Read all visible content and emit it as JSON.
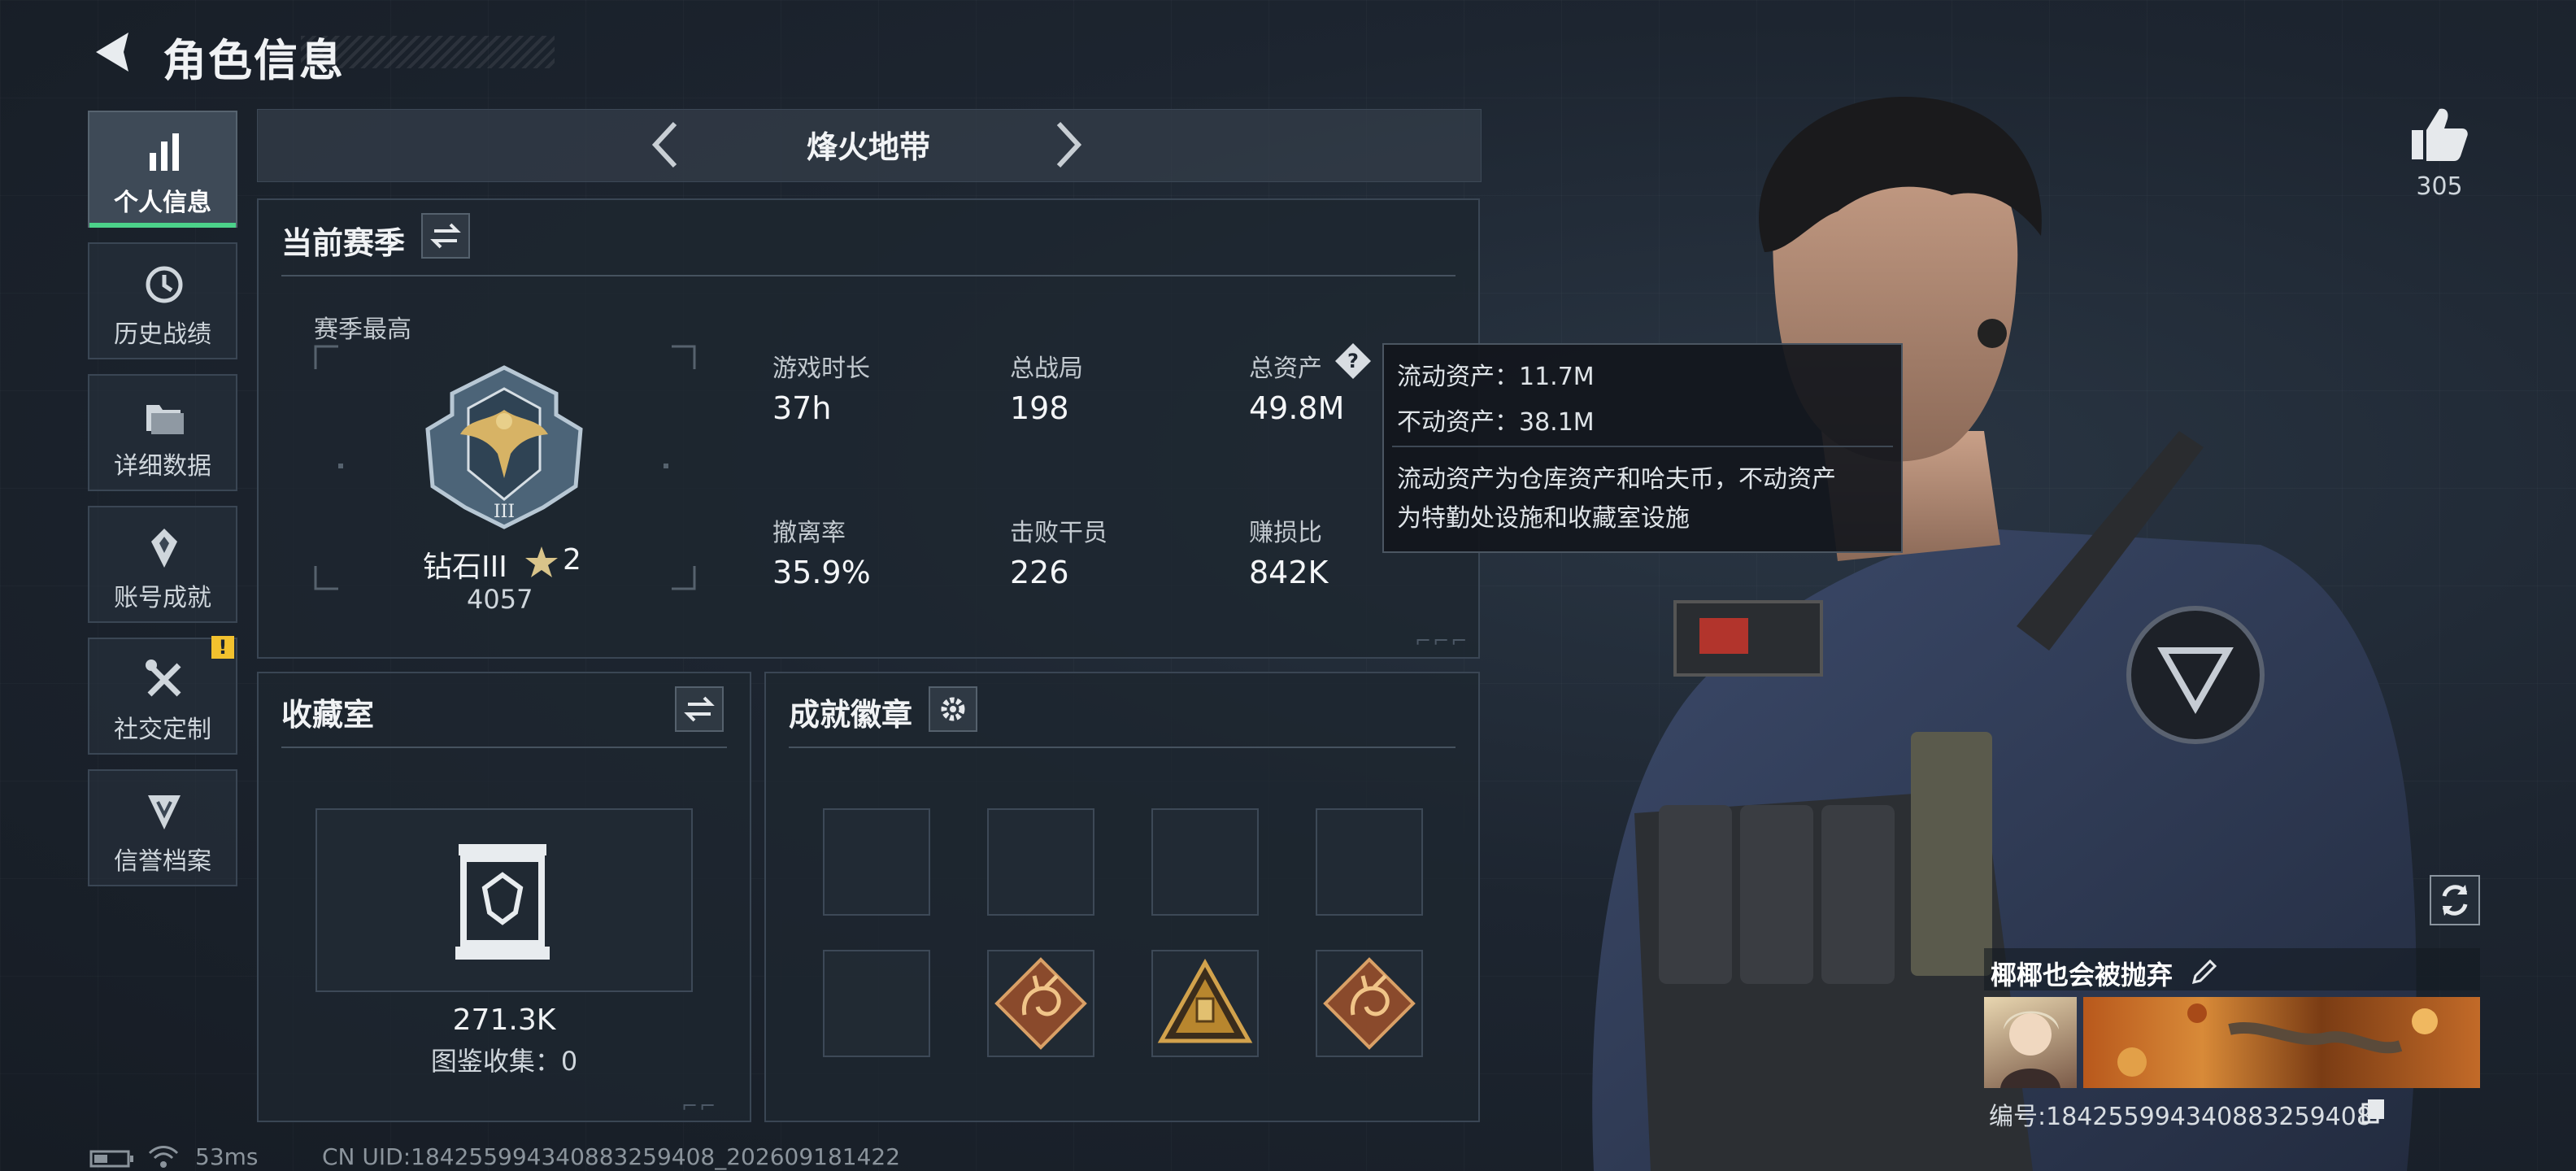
{
  "header": {
    "title": "角色信息"
  },
  "nav": [
    {
      "label": "个人信息",
      "icon": "bar-chart-icon",
      "active": true
    },
    {
      "label": "历史战绩",
      "icon": "history-icon"
    },
    {
      "label": "详细数据",
      "icon": "folder-icon"
    },
    {
      "label": "账号成就",
      "icon": "achievement-icon"
    },
    {
      "label": "社交定制",
      "icon": "tools-icon",
      "badge": "!"
    },
    {
      "label": "信誉档案",
      "icon": "reputation-icon"
    }
  ],
  "mode": {
    "title": "烽火地带"
  },
  "season": {
    "title": "当前赛季",
    "best_label": "赛季最高",
    "rank_name": "钻石III",
    "rank_stars": "2",
    "rank_score": "4057",
    "stats": [
      {
        "label": "游戏时长",
        "value": "37h"
      },
      {
        "label": "总战局",
        "value": "198"
      },
      {
        "label": "总资产",
        "value": "49.8M"
      },
      {
        "label": "撤离率",
        "value": "35.9%"
      },
      {
        "label": "击败干员",
        "value": "226"
      },
      {
        "label": "赚损比",
        "value": "842K"
      }
    ]
  },
  "tooltip": {
    "liquid": "流动资产：11.7M",
    "fixed": "不动资产：38.1M",
    "desc1": "流动资产为仓库资产和哈夫币，不动资产",
    "desc2": "为特勤处设施和收藏室设施"
  },
  "collection": {
    "title": "收藏室",
    "value": "271.3K",
    "count_label": "图鉴收集：0"
  },
  "badges": {
    "title": "成就徽章"
  },
  "profile": {
    "likes": "305",
    "name": "椰椰也会被抛弃",
    "id": "编号:1842559943408832594​08"
  },
  "status": {
    "ping": "53ms",
    "uid": "CN UID:18425599434088325940​8_202609181422"
  },
  "colors": {
    "accent": "#4cd28a",
    "warning": "#f2c12e"
  }
}
